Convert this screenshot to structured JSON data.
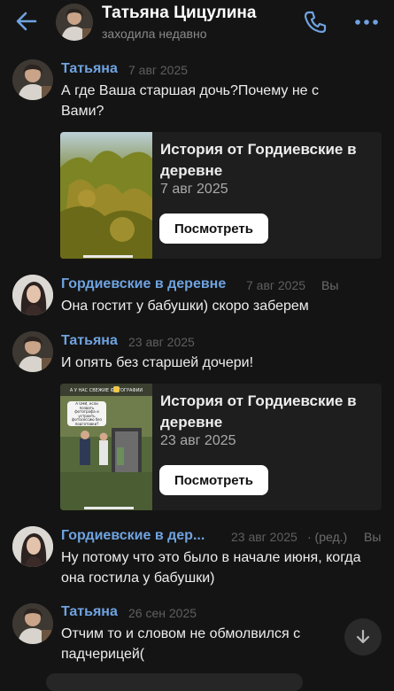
{
  "header": {
    "name": "Татьяна Цицулина",
    "status": "заходила недавно",
    "icons": {
      "back": "back-arrow-icon",
      "call": "phone-icon",
      "more": "more-dots-icon"
    }
  },
  "colors": {
    "accent": "#6fa3e0",
    "background": "#141414",
    "card": "#1e1e1e"
  },
  "messages": [
    {
      "sender": "Татьяна",
      "date": "7 авг 2025",
      "text": "А где Ваша старшая дочь?Почему не с Вами?",
      "story": {
        "title": "История от Гордиевские в деревне",
        "date": "7 авг 2025",
        "button": "Посмотреть"
      }
    },
    {
      "sender": "Гордиевские в деревне",
      "date": "7 авг 2025",
      "you": "Вы",
      "text": "Она гостит у бабушки) скоро заберем"
    },
    {
      "sender": "Татьяна",
      "date": "23 авг 2025",
      "text": "И опять без старшей дочери!",
      "story": {
        "title": "История от Гордиевские в деревне",
        "date": "23 авг 2025",
        "button": "Посмотреть",
        "thumb_caption_top": "А У НАС СВЕЖИЕ ФОТОГРАФИИ",
        "thumb_caption_bubble": "А ОНИ, если позвать фотографа и устроить фотосессию без подготовки?"
      }
    },
    {
      "sender": "Гордиевские в дер...",
      "date": "23 авг 2025",
      "edited": "· (ред.)",
      "you": "Вы",
      "text": "Ну потому что это было в начале июня, когда она гостила у бабушки)"
    },
    {
      "sender": "Татьяна",
      "date": "26 сен 2025",
      "text": "Отчим то и словом не обмолвился с падчерицей("
    }
  ],
  "scroll_down_icon": "chevron-down-icon"
}
